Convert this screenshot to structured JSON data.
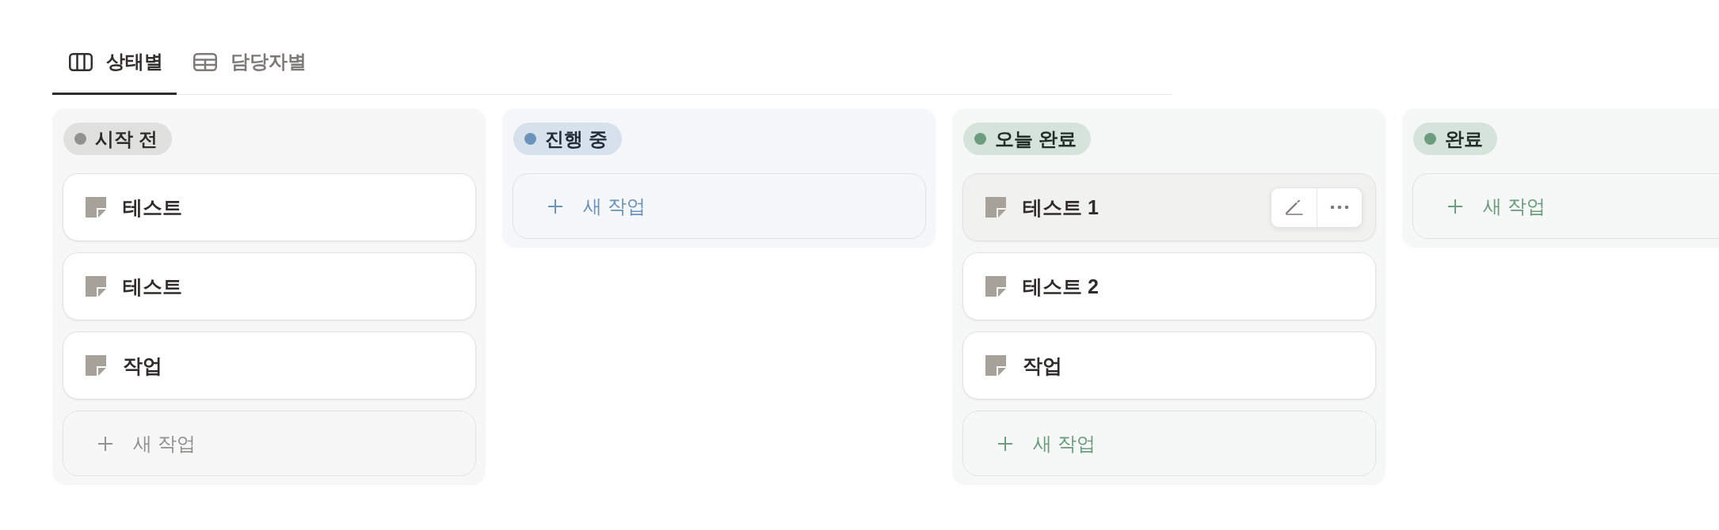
{
  "tabs": [
    {
      "label": "상태별",
      "kind": "board",
      "selected": true
    },
    {
      "label": "담당자별",
      "kind": "table",
      "selected": false
    }
  ],
  "columns": [
    {
      "status": "시작 전",
      "color": "#91918e",
      "cards": [
        {
          "title": "테스트",
          "hovered": false
        },
        {
          "title": "테스트",
          "hovered": false
        },
        {
          "title": "작업",
          "hovered": false
        }
      ],
      "add_label": "새 작업"
    },
    {
      "status": "진행 중",
      "color": "#6b93bb",
      "add_label": "새 작업"
    },
    {
      "status": "오늘 완료",
      "color": "#6c9b7d",
      "cards": [
        {
          "title": "테스트 1",
          "hovered": true
        },
        {
          "title": "테스트 2",
          "hovered": false
        },
        {
          "title": "작업",
          "hovered": false
        }
      ],
      "add_label": "새 작업"
    },
    {
      "status": "완료",
      "color": "#6c9b7d",
      "add_label": "새 작업"
    }
  ]
}
